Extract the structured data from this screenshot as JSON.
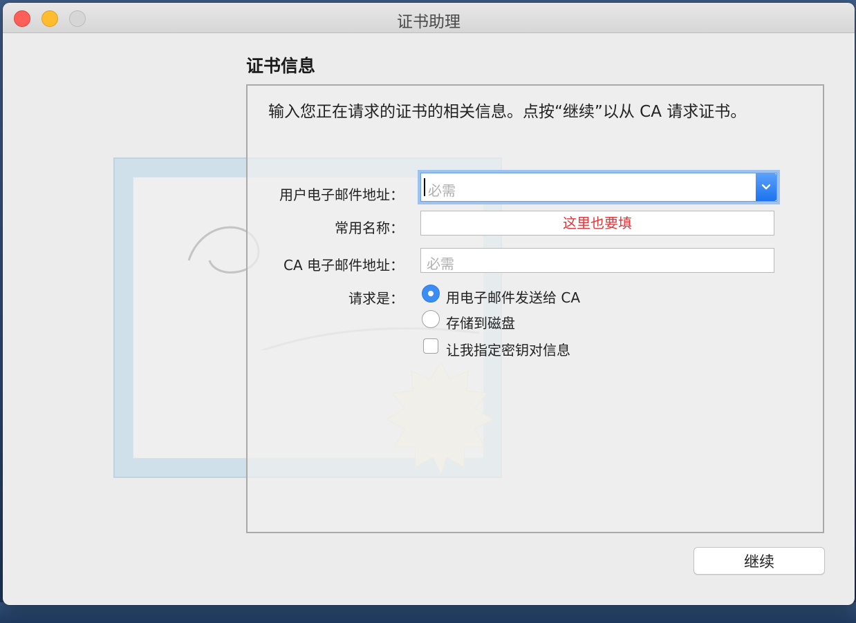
{
  "window": {
    "title": "证书助理"
  },
  "illustration": {
    "script_text": "Certificate"
  },
  "section": {
    "title": "证书信息",
    "description": "输入您正在请求的证书的相关信息。点按“继续”以从 CA 请求证书。"
  },
  "form": {
    "email": {
      "label": "用户电子邮件地址：",
      "placeholder": "必需",
      "value": ""
    },
    "common_name": {
      "label": "常用名称：",
      "value": "这里也要填",
      "value_color": "#e0363a"
    },
    "ca_email": {
      "label": "CA 电子邮件地址：",
      "placeholder": "必需",
      "value": ""
    },
    "request_label": "请求是：",
    "options": [
      {
        "label": "用电子邮件发送给 CA",
        "selected": true
      },
      {
        "label": "存储到磁盘",
        "selected": false
      }
    ],
    "key_pair_checkbox": {
      "label": "让我指定密钥对信息",
      "checked": false
    }
  },
  "buttons": {
    "continue": "继续"
  },
  "colors": {
    "accent": "#3b8cf5",
    "close": "#fe5f57",
    "minimize": "#febc2e"
  }
}
